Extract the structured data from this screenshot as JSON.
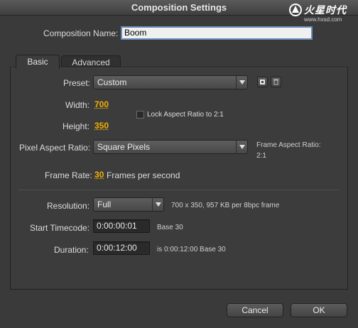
{
  "window": {
    "title": "Composition Settings"
  },
  "watermark": {
    "logo_text": "火星时代",
    "url_text": "www.hxsd.com"
  },
  "composition_name": {
    "label": "Composition Name:",
    "value": "Boom"
  },
  "tabs": [
    {
      "label": "Basic",
      "active": true
    },
    {
      "label": "Advanced",
      "active": false
    }
  ],
  "preset": {
    "label": "Preset:",
    "value": "Custom"
  },
  "width": {
    "label": "Width:",
    "value": "700"
  },
  "height": {
    "label": "Height:",
    "value": "350"
  },
  "lock_aspect": {
    "label": "Lock Aspect Ratio to 2:1",
    "checked": false
  },
  "pixel_aspect": {
    "label": "Pixel Aspect Ratio:",
    "value": "Square Pixels",
    "frame_aspect_label": "Frame Aspect Ratio:",
    "frame_aspect_value": "2:1"
  },
  "frame_rate": {
    "label": "Frame Rate:",
    "value": "30",
    "unit": "Frames per second"
  },
  "resolution": {
    "label": "Resolution:",
    "value": "Full",
    "info": "700 x 350, 957 KB per 8bpc frame"
  },
  "start_timecode": {
    "label": "Start Timecode:",
    "value": "0:00:00:01",
    "base": "Base 30"
  },
  "duration": {
    "label": "Duration:",
    "value": "0:00:12:00",
    "info": "is 0:00:12:00  Base 30"
  },
  "buttons": {
    "cancel": "Cancel",
    "ok": "OK"
  }
}
